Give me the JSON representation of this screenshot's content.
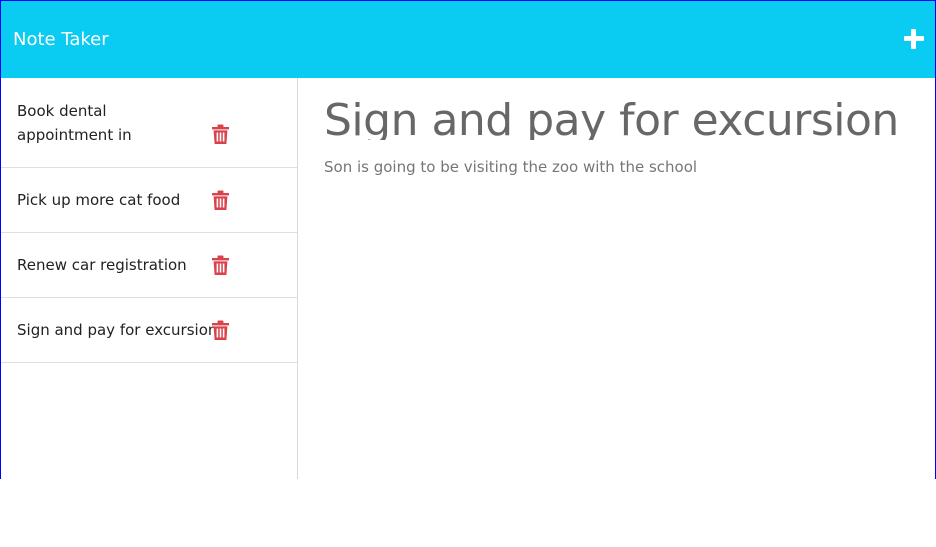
{
  "navbar": {
    "brand": "Note Taker",
    "new_note_icon": "plus-icon",
    "background": "#0acbf1"
  },
  "sidebar": {
    "notes": [
      {
        "title": "Book dental appointment in",
        "delete_icon": "trash-icon"
      },
      {
        "title": "Pick up more cat food",
        "delete_icon": "trash-icon"
      },
      {
        "title": "Renew car registration",
        "delete_icon": "trash-icon"
      },
      {
        "title": "Sign and pay for excursion",
        "delete_icon": "trash-icon"
      }
    ],
    "delete_icon_color": "#d9414b"
  },
  "main": {
    "note_title": "Sign and pay for excursion",
    "note_text": "Son is going to be visiting the zoo with the school"
  }
}
